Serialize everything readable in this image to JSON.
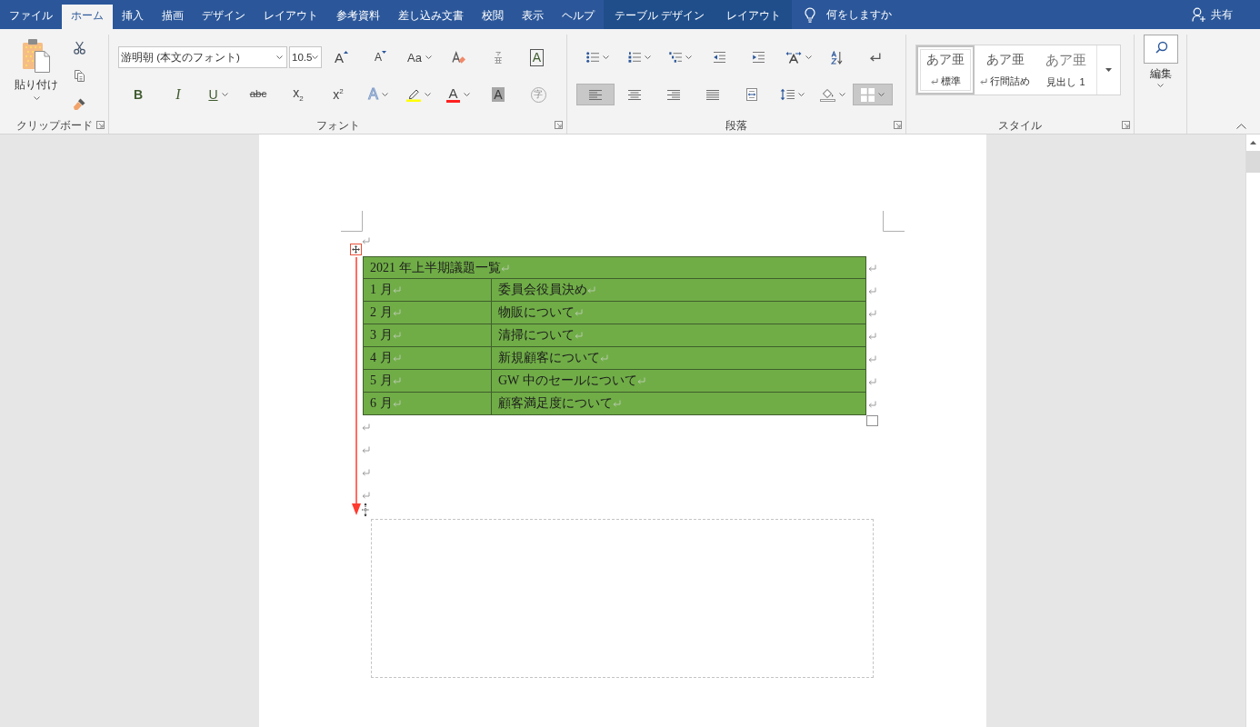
{
  "title_bar": {
    "tabs": [
      {
        "label": "ファイル",
        "selected": false,
        "contextual": false
      },
      {
        "label": "ホーム",
        "selected": true,
        "contextual": false
      },
      {
        "label": "挿入",
        "selected": false,
        "contextual": false
      },
      {
        "label": "描画",
        "selected": false,
        "contextual": false
      },
      {
        "label": "デザイン",
        "selected": false,
        "contextual": false
      },
      {
        "label": "レイアウト",
        "selected": false,
        "contextual": false
      },
      {
        "label": "参考資料",
        "selected": false,
        "contextual": false
      },
      {
        "label": "差し込み文書",
        "selected": false,
        "contextual": false
      },
      {
        "label": "校閲",
        "selected": false,
        "contextual": false
      },
      {
        "label": "表示",
        "selected": false,
        "contextual": false
      },
      {
        "label": "ヘルプ",
        "selected": false,
        "contextual": false
      },
      {
        "label": "テーブル デザイン",
        "selected": false,
        "contextual": true
      },
      {
        "label": "レイアウト",
        "selected": false,
        "contextual": true
      }
    ],
    "tell_me": "何をしますか",
    "share": "共有"
  },
  "ribbon": {
    "clipboard": {
      "paste": "貼り付け",
      "label": "クリップボード"
    },
    "font": {
      "font_name": "游明朝 (本文のフォント)",
      "font_size": "10.5",
      "label": "フォント",
      "row_1": [
        {
          "kind": "grow",
          "label": "A",
          "dropdown": false
        },
        {
          "kind": "shrink",
          "label": "A",
          "dropdown": false
        },
        {
          "kind": "case",
          "label": "Aa",
          "dropdown": true
        },
        {
          "kind": "clear",
          "dropdown": false
        },
        {
          "kind": "ruby",
          "dropdown": false
        },
        {
          "kind": "border",
          "label": "A",
          "dropdown": false
        }
      ],
      "row_2": [
        {
          "kind": "bold",
          "label": "B",
          "dropdown": false
        },
        {
          "kind": "italic",
          "label": "I",
          "dropdown": false
        },
        {
          "kind": "underline",
          "label": "U",
          "dropdown": true
        },
        {
          "kind": "strike",
          "label": "abc",
          "dropdown": false
        },
        {
          "kind": "subscript",
          "label": "x$_{2}$",
          "dropdown": false
        },
        {
          "kind": "superscript",
          "label": "x$^{2}$",
          "dropdown": false
        },
        {
          "kind": "effects",
          "label": "A",
          "dropdown": true
        },
        {
          "kind": "highlight",
          "dropdown": true
        },
        {
          "kind": "color",
          "label": "A",
          "dropdown": true
        },
        {
          "kind": "shading",
          "label": "A",
          "dropdown": false
        },
        {
          "kind": "enclose",
          "label": "字",
          "dropdown": false
        }
      ]
    },
    "paragraph": {
      "label": "段落",
      "row_1": [
        {
          "kind": "bullets",
          "dropdown": true,
          "selected": false
        },
        {
          "kind": "numbering",
          "dropdown": true,
          "selected": false
        },
        {
          "kind": "multilevel",
          "dropdown": true,
          "selected": false
        },
        {
          "kind": "outdent",
          "dropdown": false,
          "selected": false
        },
        {
          "kind": "indent",
          "dropdown": false,
          "selected": false
        },
        {
          "kind": "asian_layout",
          "dropdown": true,
          "selected": false
        },
        {
          "kind": "sort",
          "dropdown": false,
          "selected": false
        },
        {
          "kind": "show_marks",
          "dropdown": false,
          "selected": false
        }
      ],
      "row_2": [
        {
          "kind": "align_left",
          "dropdown": false,
          "selected": true
        },
        {
          "kind": "align_center",
          "dropdown": false,
          "selected": false
        },
        {
          "kind": "align_right",
          "dropdown": false,
          "selected": false
        },
        {
          "kind": "justify",
          "dropdown": false,
          "selected": false
        },
        {
          "kind": "distribute",
          "dropdown": false,
          "selected": false
        },
        {
          "kind": "line_spacing",
          "dropdown": true,
          "selected": false
        },
        {
          "kind": "shading",
          "dropdown": true,
          "selected": false
        },
        {
          "kind": "borders",
          "dropdown": true,
          "selected": true
        }
      ]
    },
    "styles": {
      "label": "スタイル",
      "items": [
        {
          "kind": "normal",
          "sample": "あア亜",
          "name": "標準",
          "paragraph_mark": true,
          "selected": true
        },
        {
          "kind": "normal",
          "sample": "あア亜",
          "name": "行間詰め",
          "paragraph_mark": true,
          "selected": false
        },
        {
          "kind": "heading",
          "sample": "あア亜",
          "name": "見出し 1",
          "paragraph_mark": false,
          "selected": false
        }
      ]
    },
    "editing": {
      "label": "編集"
    }
  },
  "document": {
    "blocks": [
      {
        "kind": "empty"
      },
      {
        "kind": "table",
        "annotated": true,
        "dragging": true,
        "rows": [
          {
            "cells": [
              "2021 年上半期議題一覧"
            ]
          },
          {
            "cells": [
              "1 月",
              "委員会役員決め"
            ]
          },
          {
            "cells": [
              "2 月",
              "物販について"
            ]
          },
          {
            "cells": [
              "3 月",
              "清掃について"
            ]
          },
          {
            "cells": [
              "4 月",
              "新規顧客について"
            ]
          },
          {
            "cells": [
              "5 月",
              "GW 中のセールについて"
            ]
          },
          {
            "cells": [
              "6 月",
              "顧客満足度について"
            ]
          }
        ]
      },
      {
        "kind": "empty"
      },
      {
        "kind": "empty"
      },
      {
        "kind": "empty"
      },
      {
        "kind": "empty"
      }
    ]
  }
}
